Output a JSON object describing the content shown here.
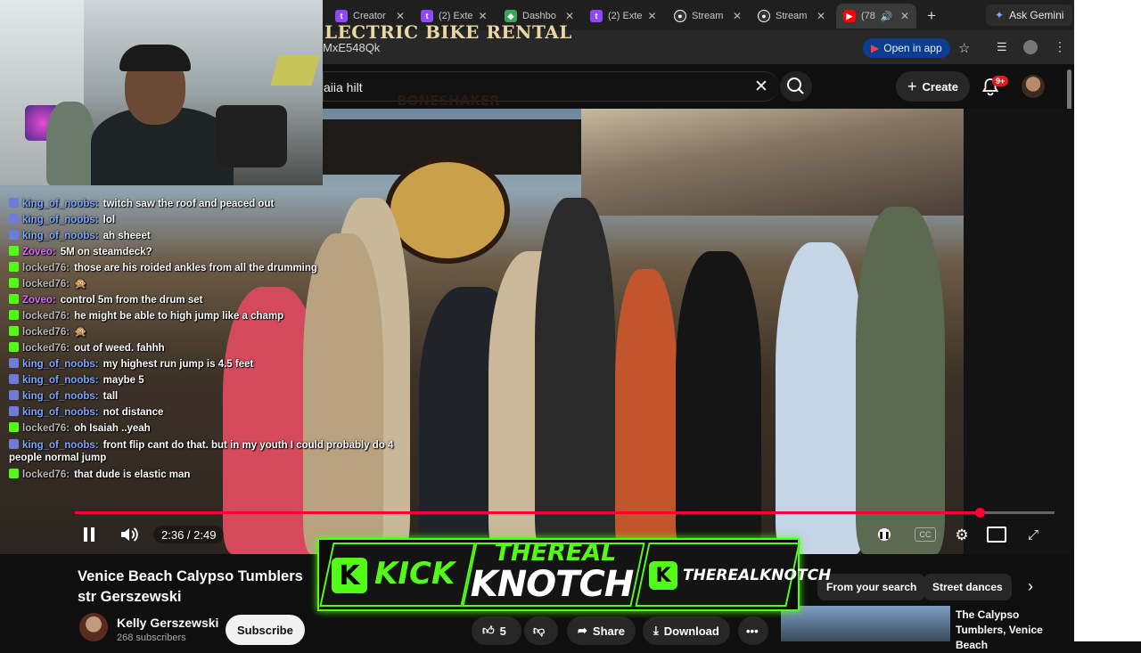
{
  "browser": {
    "tabs": [
      {
        "label": "Creator",
        "icon": "twitch-icon",
        "color": "#9146ff"
      },
      {
        "label": "(2) Exte",
        "icon": "twitch-icon",
        "color": "#9146ff"
      },
      {
        "label": "Dashbo",
        "icon": "dashboard-icon",
        "color": "#3ba55c"
      },
      {
        "label": "(2) Exte",
        "icon": "twitch-icon",
        "color": "#9146ff"
      },
      {
        "label": "Stream",
        "icon": "stream-icon",
        "color": "#ffffff"
      },
      {
        "label": "Stream",
        "icon": "stream-icon",
        "color": "#ffffff"
      },
      {
        "label": "(78",
        "icon": "youtube-icon",
        "color": "#ff0000"
      }
    ],
    "gemini_label": "Ask Gemini",
    "url": "MxE548Qk",
    "open_in_app": "Open in app"
  },
  "youtube": {
    "search_query": "aiia hilt",
    "create_label": "Create",
    "notification_count": "9+"
  },
  "video": {
    "sign_text": "LECTRIC BIKE RENTAL",
    "logo_text": "BONESHAKER",
    "current_time": "2:36",
    "duration": "2:49",
    "time_display": "2:36 / 2:49",
    "progress_fraction": 0.924,
    "accent": "#ff0033"
  },
  "chat": [
    {
      "user": "king_of_noobs:",
      "text": "twitch saw the roof and peaced out",
      "color": "#7aa7ff",
      "badge": "#6f7bd8"
    },
    {
      "user": "king_of_noobs:",
      "text": "lol",
      "color": "#7aa7ff",
      "badge": "#6f7bd8"
    },
    {
      "user": "king_of_noobs:",
      "text": "ah sheeet",
      "color": "#7aa7ff",
      "badge": "#6f7bd8"
    },
    {
      "user": "Zoveo:",
      "text": "5M on steamdeck?",
      "color": "#d86bff",
      "badge": "#53fc18"
    },
    {
      "user": "locked76:",
      "text": "those are his roided ankles from all the drumming",
      "color": "#b7b7b7",
      "badge": "#53fc18"
    },
    {
      "user": "locked76:",
      "text": "🙊",
      "color": "#b7b7b7",
      "badge": "#53fc18"
    },
    {
      "user": "Zoveo:",
      "text": "control 5m from the drum set",
      "color": "#d86bff",
      "badge": "#53fc18"
    },
    {
      "user": "locked76:",
      "text": "he might be able to high jump like a champ",
      "color": "#b7b7b7",
      "badge": "#53fc18"
    },
    {
      "user": "locked76:",
      "text": "🙊",
      "color": "#b7b7b7",
      "badge": "#53fc18"
    },
    {
      "user": "locked76:",
      "text": "out of weed. fahhh",
      "color": "#b7b7b7",
      "badge": "#53fc18"
    },
    {
      "user": "king_of_noobs:",
      "text": "my highest run jump is 4.5 feet",
      "color": "#7aa7ff",
      "badge": "#6f7bd8"
    },
    {
      "user": "king_of_noobs:",
      "text": "maybe 5",
      "color": "#7aa7ff",
      "badge": "#6f7bd8"
    },
    {
      "user": "king_of_noobs:",
      "text": "tall",
      "color": "#7aa7ff",
      "badge": "#6f7bd8"
    },
    {
      "user": "king_of_noobs:",
      "text": "not distance",
      "color": "#7aa7ff",
      "badge": "#6f7bd8"
    },
    {
      "user": "locked76:",
      "text": "oh Isaiah ..yeah",
      "color": "#b7b7b7",
      "badge": "#53fc18"
    },
    {
      "user": "king_of_noobs:",
      "text": "front flip cant do that. but in my youth I could probably do 4 people normal jump",
      "color": "#7aa7ff",
      "badge": "#6f7bd8",
      "wrap": true
    },
    {
      "user": "locked76:",
      "text": "that dude is elastic man",
      "color": "#b7b7b7",
      "badge": "#53fc18"
    }
  ],
  "below": {
    "title": "Venice Beach Calypso Tumblers str Gerszewski",
    "channel": "Kelly Gerszewski",
    "subscribers": "268 subscribers",
    "subscribe_label": "Subscribe",
    "likes": "5",
    "share_label": "Share",
    "download_label": "Download",
    "chips": [
      "From your search",
      "Street dances"
    ],
    "side_title": "The Calypso Tumblers,  Venice Beach"
  },
  "overlay": {
    "kick_label": "KICK",
    "name_top": "THEREAL",
    "name_bottom": "KNOTCH",
    "handle": "THEREALKNOTCH",
    "k_letter": "K",
    "accent": "#53fc18"
  }
}
